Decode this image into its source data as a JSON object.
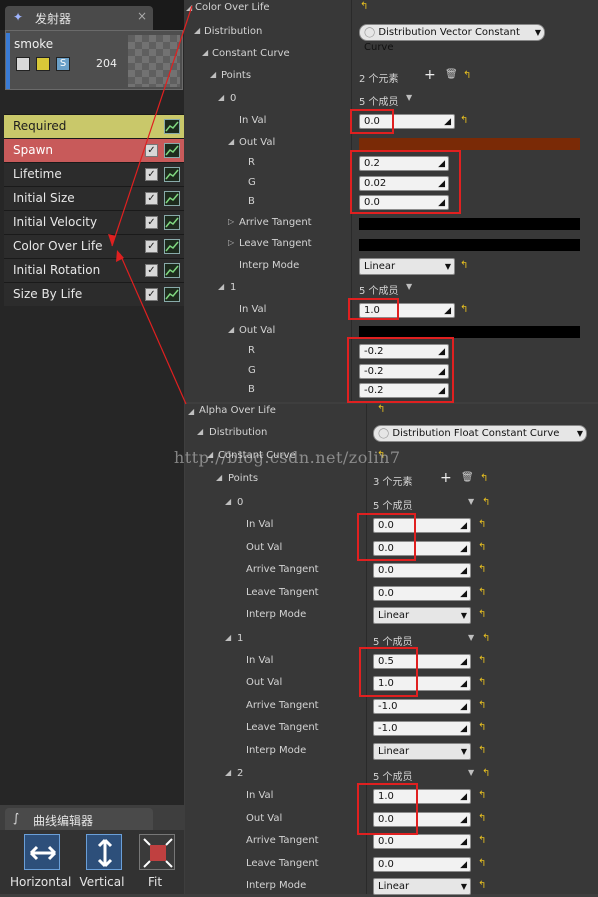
{
  "emitter_tab": {
    "label": "发射器",
    "close": "×"
  },
  "emitter": {
    "name": "smoke",
    "count": "204",
    "icon_labels": [
      "",
      "",
      "S"
    ]
  },
  "modules": [
    {
      "label": "Required",
      "bg": "#c9c86a",
      "fg": "#1e1e1e",
      "check": false
    },
    {
      "label": "Spawn",
      "bg": "#c85a5a",
      "fg": "#ffffff",
      "check": true
    },
    {
      "label": "Lifetime",
      "bg": "#2c2c2c",
      "fg": "#e8e8e8",
      "check": true
    },
    {
      "label": "Initial Size",
      "bg": "#2c2c2c",
      "fg": "#e8e8e8",
      "check": true
    },
    {
      "label": "Initial Velocity",
      "bg": "#2c2c2c",
      "fg": "#e8e8e8",
      "check": true
    },
    {
      "label": "Color Over Life",
      "bg": "#2c2c2c",
      "fg": "#e8e8e8",
      "check": true
    },
    {
      "label": "Initial Rotation",
      "bg": "#2c2c2c",
      "fg": "#e8e8e8",
      "check": true
    },
    {
      "label": "Size By Life",
      "bg": "#2c2c2c",
      "fg": "#e8e8e8",
      "check": true
    }
  ],
  "curve_editor": {
    "tab_label": "曲线编辑器",
    "buttons": [
      "Horizontal",
      "Vertical",
      "Fit"
    ]
  },
  "color_over_life": {
    "title": "Color Over Life",
    "distribution_label": "Distribution",
    "distribution_value": "Distribution Vector Constant Curve",
    "constant_curve": "Constant Curve",
    "points_label": "Points",
    "points_count": "2 个元素",
    "point0": {
      "index": "0",
      "members": "5 个成员",
      "in_val_label": "In Val",
      "in_val": "0.0",
      "out_val_label": "Out Val",
      "r_label": "R",
      "r": "0.2",
      "g_label": "G",
      "g": "0.02",
      "b_label": "B",
      "b": "0.0",
      "arrive": "Arrive Tangent",
      "leave": "Leave Tangent",
      "interp_label": "Interp Mode",
      "interp": "Linear"
    },
    "point1": {
      "index": "1",
      "members": "5 个成员",
      "in_val_label": "In Val",
      "in_val": "1.0",
      "out_val_label": "Out Val",
      "r_label": "R",
      "r": "-0.2",
      "g_label": "G",
      "g": "-0.2",
      "b_label": "B",
      "b": "-0.2"
    }
  },
  "alpha_over_life": {
    "title": "Alpha Over Life",
    "distribution_label": "Distribution",
    "distribution_value": "Distribution Float Constant Curve",
    "constant_curve": "Constant Curve",
    "points_label": "Points",
    "points_count": "3 个元素",
    "labels": {
      "in_val": "In Val",
      "out_val": "Out Val",
      "arrive": "Arrive Tangent",
      "leave": "Leave Tangent",
      "interp": "Interp Mode"
    },
    "points": [
      {
        "index": "0",
        "members": "5 个成员",
        "in_val": "0.0",
        "out_val": "0.0",
        "arrive": "0.0",
        "leave": "0.0",
        "interp": "Linear"
      },
      {
        "index": "1",
        "members": "5 个成员",
        "in_val": "0.5",
        "out_val": "1.0",
        "arrive": "-1.0",
        "leave": "-1.0",
        "interp": "Linear"
      },
      {
        "index": "2",
        "members": "5 个成员",
        "in_val": "1.0",
        "out_val": "0.0",
        "arrive": "0.0",
        "leave": "0.0",
        "interp": "Linear"
      }
    ]
  },
  "watermark": "http://blog.csdn.net/zolin7",
  "colors": {
    "highlight_box": "#e02020",
    "reset_arrow": "#e8c020",
    "color_swatch": "#7a2a06",
    "emitter_stripe": "#3a7bd5"
  }
}
